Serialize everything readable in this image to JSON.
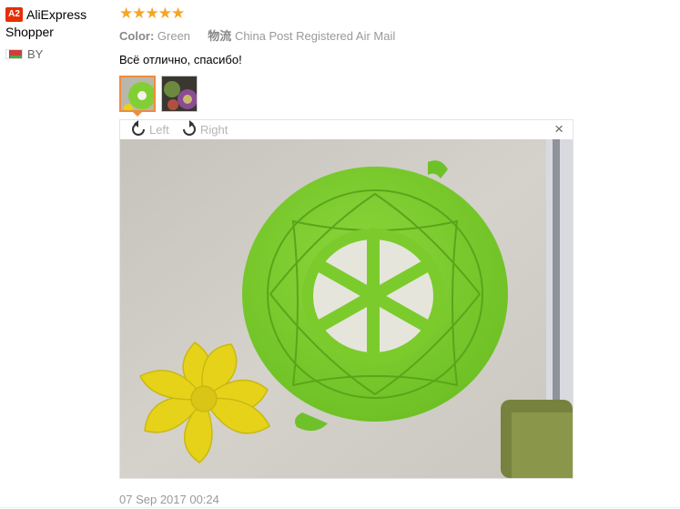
{
  "user": {
    "badge": "A2",
    "name_line1": "AliExpress",
    "name_line2": "Shopper",
    "country_code": "BY"
  },
  "review": {
    "stars": "★★★★★",
    "rating": 5,
    "color_label": "Color:",
    "color_value": "Green",
    "shipping_label": "物流",
    "shipping_value": "China Post Registered Air Mail",
    "text": "Всё отлично, спасибо!",
    "date": "07 Sep 2017 00:24"
  },
  "viewer": {
    "rotate_left": "Left",
    "rotate_right": "Right",
    "close": "×"
  },
  "colors": {
    "star": "#f5a623",
    "badge": "#e62e04",
    "active_thumb": "#f08c3c",
    "lid_green": "#7ccb2c",
    "flower_yellow": "#e6d319"
  }
}
